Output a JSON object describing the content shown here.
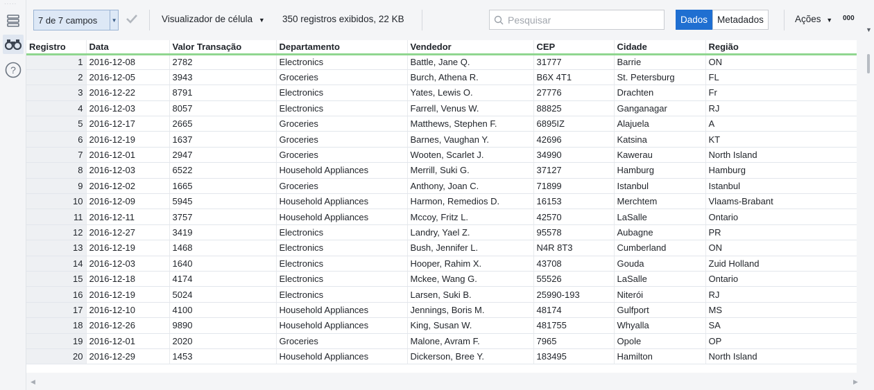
{
  "toolbar": {
    "fields_selector": "7 de 7 campos",
    "cell_viewer": "Visualizador de célula",
    "records_info": "350 registros exibidos, 22 KB",
    "search_placeholder": "Pesquisar",
    "data_tab": "Dados",
    "metadata_tab": "Metadados",
    "actions": "Ações",
    "more": "000"
  },
  "accent_color": "#1f6fd1",
  "header_underline_color": "#8fd68f",
  "columns": [
    "Registro",
    "Data",
    "Valor Transação",
    "Departamento",
    "Vendedor",
    "CEP",
    "Cidade",
    "Região"
  ],
  "rows": [
    [
      "1",
      "2016-12-08",
      "2782",
      "Electronics",
      "Battle, Jane Q.",
      "31777",
      "Barrie",
      "ON"
    ],
    [
      "2",
      "2016-12-05",
      "3943",
      "Groceries",
      "Burch, Athena R.",
      "B6X 4T1",
      "St. Petersburg",
      "FL"
    ],
    [
      "3",
      "2016-12-22",
      "8791",
      "Electronics",
      "Yates, Lewis O.",
      "27776",
      "Drachten",
      "Fr"
    ],
    [
      "4",
      "2016-12-03",
      "8057",
      "Electronics",
      "Farrell, Venus W.",
      "88825",
      "Ganganagar",
      "RJ"
    ],
    [
      "5",
      "2016-12-17",
      "2665",
      "Groceries",
      "Matthews, Stephen F.",
      "6895IZ",
      "Alajuela",
      "A"
    ],
    [
      "6",
      "2016-12-19",
      "1637",
      "Groceries",
      "Barnes, Vaughan Y.",
      "42696",
      "Katsina",
      "KT"
    ],
    [
      "7",
      "2016-12-01",
      "2947",
      "Groceries",
      "Wooten, Scarlet J.",
      "34990",
      "Kawerau",
      "North Island"
    ],
    [
      "8",
      "2016-12-03",
      "6522",
      "Household Appliances",
      "Merrill, Suki G.",
      "37127",
      "Hamburg",
      "Hamburg"
    ],
    [
      "9",
      "2016-12-02",
      "1665",
      "Groceries",
      "Anthony, Joan C.",
      "71899",
      "Istanbul",
      "Istanbul"
    ],
    [
      "10",
      "2016-12-09",
      "5945",
      "Household Appliances",
      "Harmon, Remedios D.",
      "16153",
      "Merchtem",
      "Vlaams-Brabant"
    ],
    [
      "11",
      "2016-12-11",
      "3757",
      "Household Appliances",
      "Mccoy, Fritz L.",
      "42570",
      "LaSalle",
      "Ontario"
    ],
    [
      "12",
      "2016-12-27",
      "3419",
      "Electronics",
      "Landry, Yael Z.",
      "95578",
      "Aubagne",
      "PR"
    ],
    [
      "13",
      "2016-12-19",
      "1468",
      "Electronics",
      "Bush, Jennifer L.",
      "N4R 8T3",
      "Cumberland",
      "ON"
    ],
    [
      "14",
      "2016-12-03",
      "1640",
      "Electronics",
      "Hooper, Rahim X.",
      "43708",
      "Gouda",
      "Zuid Holland"
    ],
    [
      "15",
      "2016-12-18",
      "4174",
      "Electronics",
      "Mckee, Wang G.",
      "55526",
      "LaSalle",
      "Ontario"
    ],
    [
      "16",
      "2016-12-19",
      "5024",
      "Electronics",
      "Larsen, Suki B.",
      "25990-193",
      "Niterói",
      "RJ"
    ],
    [
      "17",
      "2016-12-10",
      "4100",
      "Household Appliances",
      "Jennings, Boris M.",
      "48174",
      "Gulfport",
      "MS"
    ],
    [
      "18",
      "2016-12-26",
      "9890",
      "Household Appliances",
      "King, Susan W.",
      "481755",
      "Whyalla",
      "SA"
    ],
    [
      "19",
      "2016-12-01",
      "2020",
      "Groceries",
      "Malone, Avram F.",
      "7965",
      "Opole",
      "OP"
    ],
    [
      "20",
      "2016-12-29",
      "1453",
      "Household Appliances",
      "Dickerson, Bree Y.",
      "183495",
      "Hamilton",
      "North Island"
    ]
  ]
}
